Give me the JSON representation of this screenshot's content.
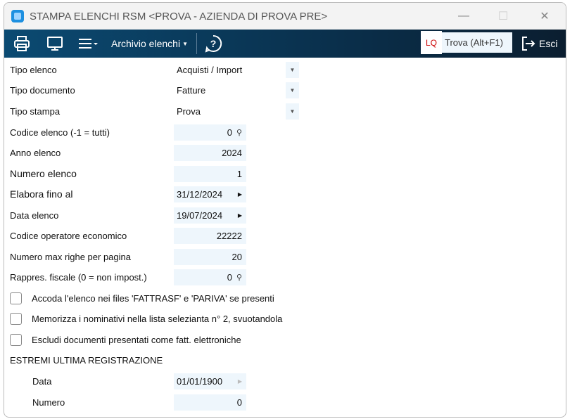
{
  "window": {
    "title": "STAMPA ELENCHI RSM <PROVA - AZIENDA DI PROVA PRE>",
    "minimize": "—",
    "maximize": "☐",
    "close": "✕"
  },
  "toolbar": {
    "archivio": "Archivio elenchi",
    "lq": "LQ",
    "find_placeholder": "Trova (Alt+F1)",
    "exit": "Esci"
  },
  "form": {
    "tipo_elenco": {
      "label": "Tipo elenco",
      "value": "Acquisti / Import"
    },
    "tipo_documento": {
      "label": "Tipo documento",
      "value": "Fatture"
    },
    "tipo_stampa": {
      "label": "Tipo stampa",
      "value": "Prova"
    },
    "codice_elenco": {
      "label": "Codice elenco (-1 = tutti)",
      "value": "0"
    },
    "anno_elenco": {
      "label": "Anno elenco",
      "value": "2024"
    },
    "numero_elenco": {
      "label": "Numero elenco",
      "value": "1"
    },
    "elabora_fino": {
      "label": "Elabora fino al",
      "value": "31/12/2024"
    },
    "data_elenco": {
      "label": "Data elenco",
      "value": "19/07/2024"
    },
    "codice_operatore": {
      "label": "Codice operatore economico",
      "value": "22222"
    },
    "max_righe": {
      "label": "Numero max righe per pagina",
      "value": "20"
    },
    "rappres_fiscale": {
      "label": "Rappres. fiscale (0 = non impost.)",
      "value": "0"
    },
    "checkboxes": [
      {
        "label": "Accoda l'elenco nei files 'FATTRASF' e 'PARIVA' se presenti",
        "checked": false
      },
      {
        "label": "Memorizza i nominativi nella lista selezianta n° 2, svuotandola",
        "checked": false
      },
      {
        "label": "Escludi documenti presentati come fatt. elettroniche",
        "checked": false
      }
    ],
    "section_title": "ESTREMI ULTIMA REGISTRAZIONE",
    "ultima_data": {
      "label": "Data",
      "value": "01/01/1900"
    },
    "ultima_numero": {
      "label": "Numero",
      "value": "0"
    }
  }
}
